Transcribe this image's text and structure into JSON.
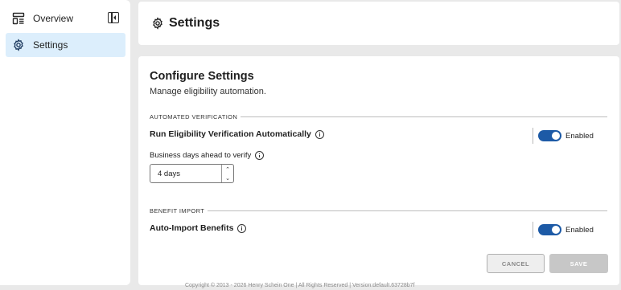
{
  "sidebar": {
    "items": [
      {
        "label": "Overview",
        "icon": "dashboard-layout-icon",
        "active": false
      },
      {
        "label": "Settings",
        "icon": "gear-icon",
        "active": true
      }
    ],
    "collapse_icon": "sidebar-collapse-icon"
  },
  "header": {
    "title": "Settings",
    "icon": "gear-icon"
  },
  "main": {
    "title": "Configure Settings",
    "subtitle": "Manage eligibility automation.",
    "groups": [
      {
        "label": "AUTOMATED VERIFICATION",
        "setting_label": "Run Eligibility Verification Automatically",
        "toggle_state": "Enabled",
        "field_label": "Business days ahead to verify",
        "field_value": "4 days"
      },
      {
        "label": "BENEFIT IMPORT",
        "setting_label": "Auto-Import Benefits",
        "toggle_state": "Enabled"
      }
    ],
    "cancel_label": "CANCEL",
    "save_label": "SAVE"
  },
  "footer": "Copyright © 2013 - 2026 Henry Schein One | All Rights Reserved | Version:default.63728b7f",
  "colors": {
    "accent": "#1d5aa6",
    "active_nav_bg": "#dceefc",
    "page_bg": "#e9e9e9"
  }
}
